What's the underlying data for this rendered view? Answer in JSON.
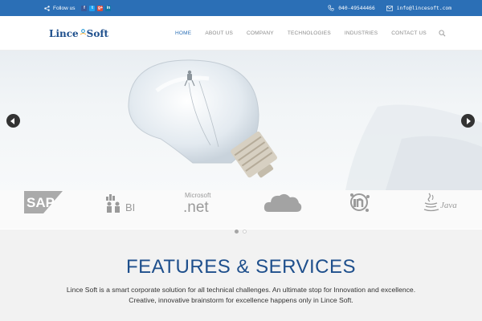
{
  "topbar": {
    "follow_label": "Follow us",
    "social": [
      "f",
      "t",
      "g+",
      "in"
    ],
    "phone": "040-49544466",
    "email": "info@lincesoft.com"
  },
  "brand": {
    "name_part1": "Lince",
    "name_part2": "Soft"
  },
  "nav": {
    "items": [
      "HOME",
      "ABOUT US",
      "COMPANY",
      "TECHNOLOGIES",
      "INDUSTRIES",
      "CONTACT US"
    ],
    "active_index": 0
  },
  "tech_logos": {
    "sap": "SAP",
    "bi": "BI",
    "dotnet_top": "Microsoft",
    "dotnet": ".net",
    "java": "Java"
  },
  "features": {
    "title": "FEATURES & SERVICES",
    "line1": "Lince Soft is a smart corporate solution for all technical challenges. An ultimate stop for Innovation and excellence.",
    "line2": "Creative, innovative brainstorm for excellence happens only in Lince Soft."
  },
  "colors": {
    "topbar": "#2b6fb6",
    "brand": "#1e4f8c",
    "nav_active": "#2b6fb6"
  }
}
